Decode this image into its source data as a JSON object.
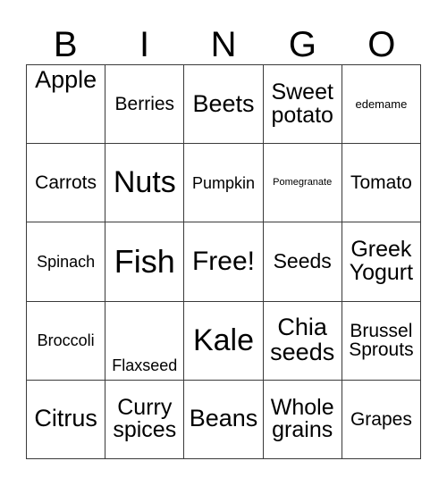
{
  "card": {
    "header_letters": [
      "B",
      "I",
      "N",
      "G",
      "O"
    ],
    "rows": [
      [
        {
          "text": "Apple",
          "size": "fs-ll",
          "valign": "va-top"
        },
        {
          "text": "Berries",
          "size": "fs-m",
          "valign": ""
        },
        {
          "text": "Beets",
          "size": "fs-ll",
          "valign": ""
        },
        {
          "text": "Sweet potato",
          "size": "fs-l",
          "valign": ""
        },
        {
          "text": "edemame",
          "size": "fs-xs",
          "valign": ""
        }
      ],
      [
        {
          "text": "Carrots",
          "size": "fs-m",
          "valign": ""
        },
        {
          "text": "Nuts",
          "size": "fs-xxl",
          "valign": ""
        },
        {
          "text": "Pumpkin",
          "size": "fs-s",
          "valign": ""
        },
        {
          "text": "Pomegranate",
          "size": "fs-xxs",
          "valign": ""
        },
        {
          "text": "Tomato",
          "size": "fs-m",
          "valign": ""
        }
      ],
      [
        {
          "text": "Spinach",
          "size": "fs-s",
          "valign": ""
        },
        {
          "text": "Fish",
          "size": "fs-xxxl",
          "valign": ""
        },
        {
          "text": "Free!",
          "size": "fs-xl",
          "valign": ""
        },
        {
          "text": "Seeds",
          "size": "fs-mm",
          "valign": ""
        },
        {
          "text": "Greek Yogurt",
          "size": "fs-l",
          "valign": ""
        }
      ],
      [
        {
          "text": "Broccoli",
          "size": "fs-s",
          "valign": ""
        },
        {
          "text": "Flaxseed",
          "size": "fs-s",
          "valign": "va-bottom"
        },
        {
          "text": "Kale",
          "size": "fs-xxl",
          "valign": ""
        },
        {
          "text": "Chia seeds",
          "size": "fs-ll",
          "valign": ""
        },
        {
          "text": "Brussel Sprouts",
          "size": "fs-m",
          "valign": ""
        }
      ],
      [
        {
          "text": "Citrus",
          "size": "fs-ll",
          "valign": ""
        },
        {
          "text": "Curry spices",
          "size": "fs-l",
          "valign": ""
        },
        {
          "text": "Beans",
          "size": "fs-ll",
          "valign": ""
        },
        {
          "text": "Whole grains",
          "size": "fs-l",
          "valign": ""
        },
        {
          "text": "Grapes",
          "size": "fs-m",
          "valign": ""
        }
      ]
    ]
  },
  "colors": {
    "border": "#3a3a3a",
    "text": "#000000",
    "background": "#ffffff"
  }
}
